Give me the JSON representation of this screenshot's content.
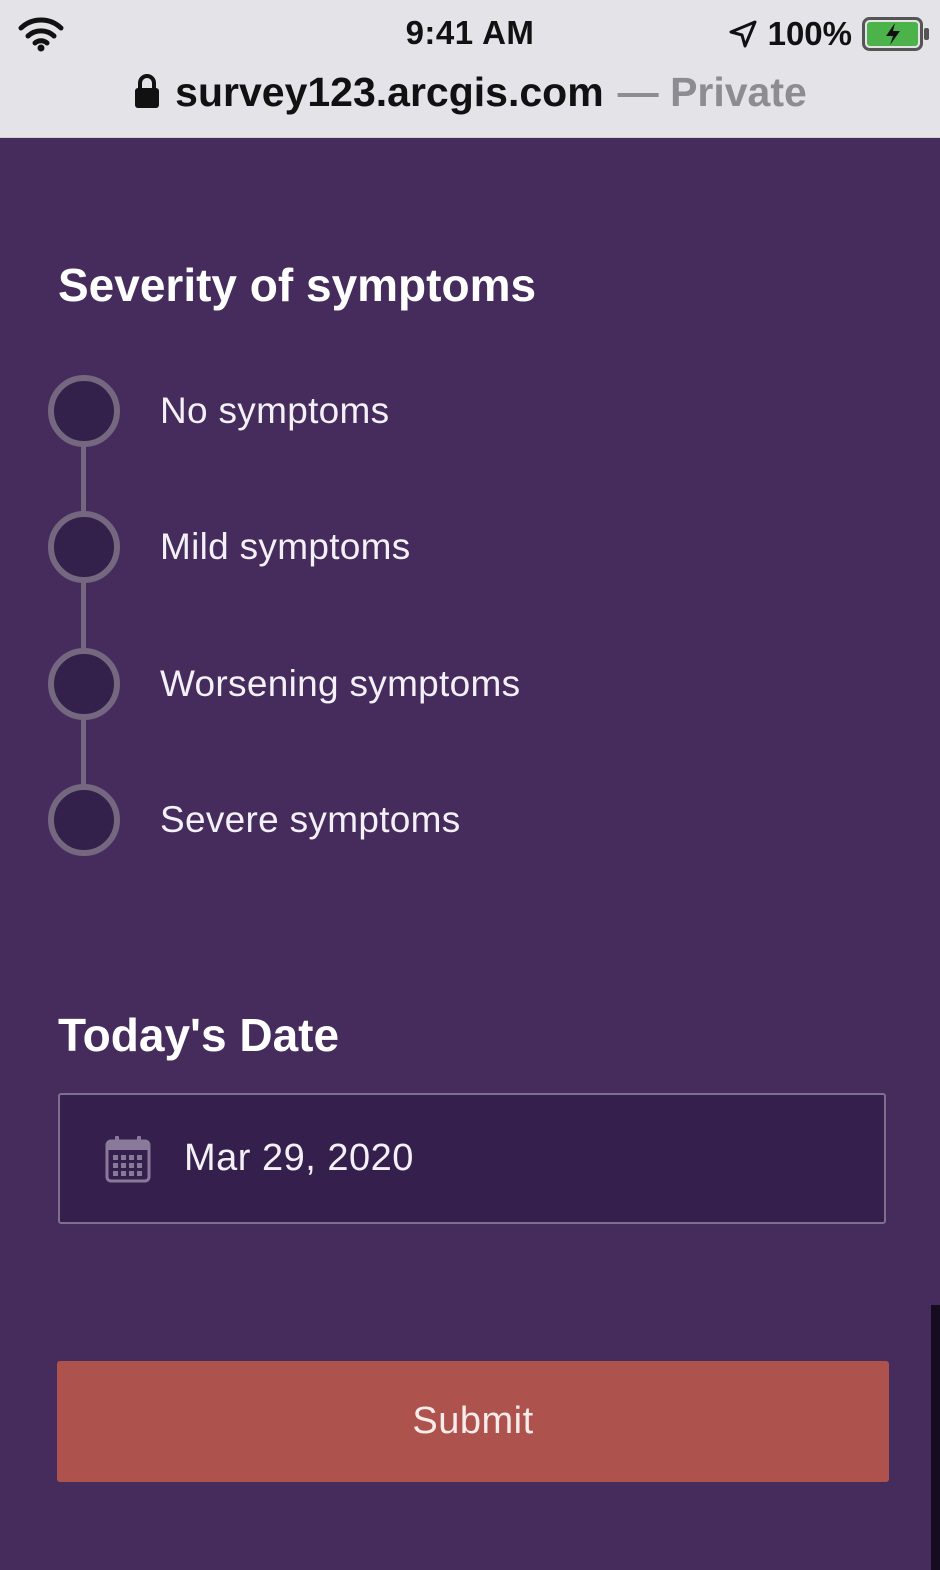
{
  "status_bar": {
    "time": "9:41 AM",
    "battery": "100%",
    "icons": [
      "wifi-icon",
      "location-arrow-icon",
      "battery-charging-icon"
    ]
  },
  "browser": {
    "domain": "survey123.arcgis.com",
    "mode": "— Private",
    "lock_icon": "lock-icon"
  },
  "form": {
    "severity": {
      "title": "Severity of symptoms",
      "options": [
        {
          "label": "No symptoms"
        },
        {
          "label": "Mild symptoms"
        },
        {
          "label": "Worsening symptoms"
        },
        {
          "label": "Severe symptoms"
        }
      ],
      "selected": null
    },
    "date": {
      "title": "Today's Date",
      "value": "Mar 29, 2020",
      "icon": "calendar-icon"
    },
    "submit_label": "Submit"
  },
  "colors": {
    "background": "#452c5c",
    "field_background": "#351f4c",
    "radio_border": "#75677f",
    "submit": "#ad524d",
    "text": "#ffffff",
    "browser_bar": "#e4e3e8"
  }
}
